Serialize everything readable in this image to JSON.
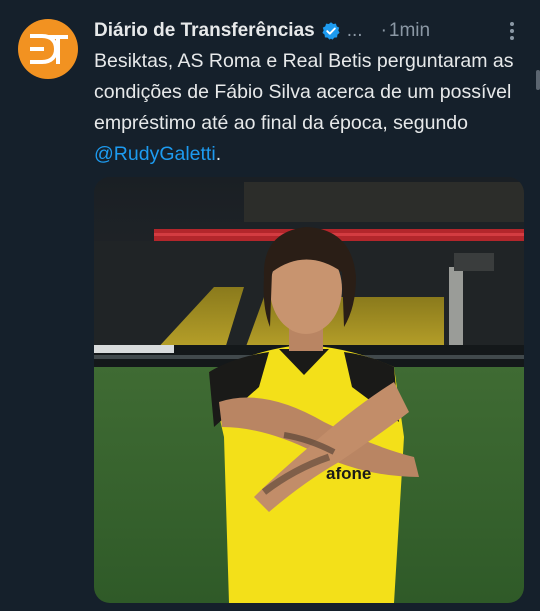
{
  "tweet": {
    "author_name": "Diário de Transferências",
    "handle_truncated": "...",
    "separator": "·",
    "time": "1min",
    "more_icon": "more-vertical-icon",
    "verified_icon": "verified-badge-icon",
    "text_main": "Besiktas, AS Roma e Real Betis perguntaram as condições de Fábio Silva acerca de um possível empréstimo até ao final da época, segundo ",
    "mention": "@RudyGaletti",
    "text_end": ".",
    "avatar_initials": "DT"
  },
  "media": {
    "sponsor_text": "vodafone",
    "shirt_text": "afone"
  },
  "colors": {
    "background": "#15202b",
    "accent": "#1d9bf0",
    "avatar": "#f29221",
    "shirt_yellow": "#f3e019"
  }
}
